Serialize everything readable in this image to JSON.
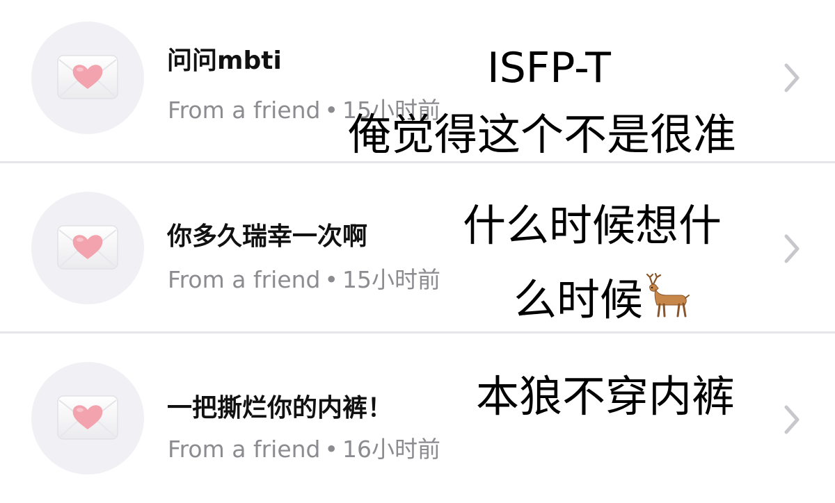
{
  "notifications": [
    {
      "title": "问问mbti",
      "sender": "From a friend",
      "separator": "•",
      "time": "15小时前",
      "icon": "love-letter-icon"
    },
    {
      "title": "你多久瑞幸一次啊",
      "sender": "From a friend",
      "separator": "•",
      "time": "15小时前",
      "icon": "love-letter-icon"
    },
    {
      "title": "一把撕烂你的内裤！",
      "sender": "From a friend",
      "separator": "•",
      "time": "16小时前",
      "icon": "love-letter-icon"
    }
  ],
  "overlay_answers": [
    {
      "line1": "ISFP-T",
      "line2": "俺觉得这个不是很准"
    },
    {
      "line1": "什么时候想什",
      "line2": "么时候",
      "emoji": "deer-icon"
    },
    {
      "line1": "本狼不穿内裤"
    }
  ],
  "colors": {
    "background": "#ffffff",
    "avatar_bg": "#f1f1f5",
    "divider": "#e6e6ea",
    "meta_text": "#8b8b90",
    "heart": "#f2a3ad",
    "chevron": "#c7c7cc"
  }
}
